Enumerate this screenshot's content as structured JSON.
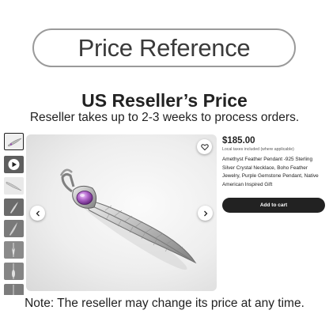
{
  "banner": {
    "title": "Price Reference"
  },
  "header": {
    "heading": "US Reseller’s Price",
    "subheading": "Reseller takes up to 2-3 weeks to process orders."
  },
  "gallery": {
    "thumbnails": [
      {
        "type": "feather-pendant",
        "selected": true
      },
      {
        "type": "video",
        "selected": false
      },
      {
        "type": "feather-pendant",
        "selected": false
      },
      {
        "type": "feather-pendant",
        "selected": false
      },
      {
        "type": "feather-pendant",
        "selected": false
      },
      {
        "type": "feather-pendant",
        "selected": false
      },
      {
        "type": "feather-pendant",
        "selected": false
      },
      {
        "type": "feather-pendant",
        "selected": false
      }
    ],
    "icons": {
      "favorite": "heart-icon",
      "previous": "chevron-left-icon",
      "next": "chevron-right-icon",
      "video": "play-icon"
    }
  },
  "product": {
    "price": "$185.00",
    "tax_note": "Local taxes included (where applicable)",
    "title": "Amethyst Feather Pendant -925 Sterling Silver Crystal Necklace, Boho Feather Jewelry, Purple Gemstone Pendant, Native American Inspired Gift",
    "add_to_cart_label": "Add to cart"
  },
  "footer": {
    "note": "Note: The reseller may change its price at any time."
  },
  "colors": {
    "button": "#222222",
    "banner_border": "#9a9a9a",
    "gem": "#9b4fb5"
  }
}
